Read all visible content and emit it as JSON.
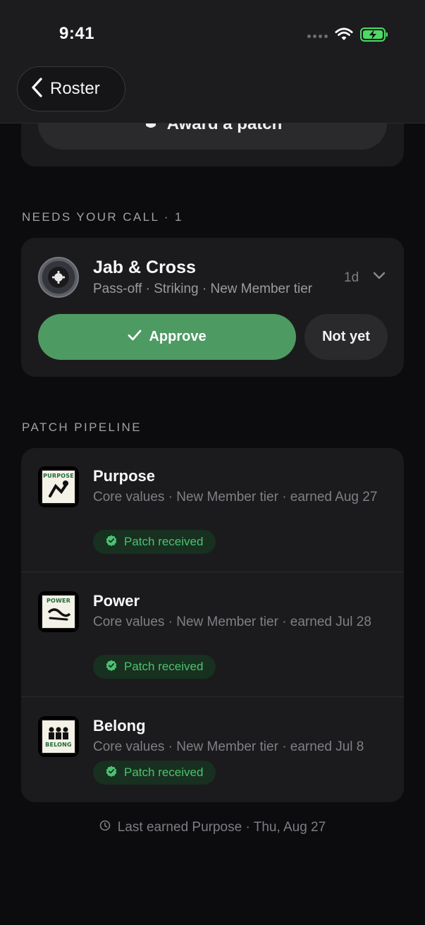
{
  "status_bar": {
    "time": "9:41"
  },
  "nav": {
    "back_label": "Roster"
  },
  "award": {
    "button_label": "Award a patch"
  },
  "needs_call": {
    "section_title": "NEEDS YOUR CALL · 1",
    "item": {
      "title": "Jab & Cross",
      "subtitle": "Pass-off · Striking · New Member tier",
      "age": "1d",
      "approve_label": "Approve",
      "not_yet_label": "Not yet"
    }
  },
  "pipeline": {
    "section_title": "PATCH PIPELINE",
    "items": [
      {
        "name": "Purpose",
        "patch_word": "PURPOSE",
        "subtitle": "Core values · New Member tier · earned Aug 27",
        "status": "Patch received"
      },
      {
        "name": "Power",
        "patch_word": "POWER",
        "subtitle": "Core values · New Member tier · earned Jul 28",
        "status": "Patch received"
      },
      {
        "name": "Belong",
        "patch_word": "BELONG",
        "subtitle": "Core values · New Member tier · earned Jul 8",
        "status": "Patch received"
      }
    ]
  },
  "footer": {
    "last_earned": "Last earned Purpose · Thu, Aug 27"
  },
  "colors": {
    "approve_green": "#4e9a63",
    "status_green": "#4cc173",
    "background": "#0c0c0e",
    "card": "#1b1b1d"
  }
}
